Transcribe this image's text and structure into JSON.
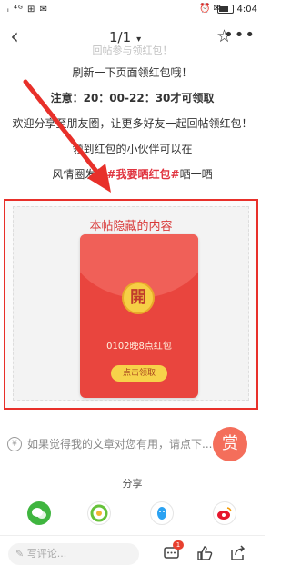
{
  "status_bar": {
    "left": "ᵢ ⁴ᴳ ⊞ ✉",
    "time": "4:04",
    "icons": "⏰ ✉"
  },
  "nav": {
    "back": "‹",
    "page_indicator": "1/1",
    "chevron": "▾",
    "favorite": "☆",
    "more": "•••"
  },
  "article": {
    "faded_line": "回帖参与领红包！",
    "refresh_line": "刷新一下页面领红包哦！",
    "note_label": "注意：",
    "note_time": "20：00-22：30才可领取",
    "invite_line": "欢迎分享至朋友圈，让更多好友一起回帖领红包！",
    "received_line": "领到红包的小伙伴可以在",
    "moment_prefix": "风情圈发帖",
    "moment_tag": "#我要晒红包#",
    "moment_suffix": "晒一晒"
  },
  "hidden_content": {
    "title": "本帖隐藏的内容",
    "open_symbol": "開",
    "packet_title": "0102晚8点红包",
    "claim_label": "点击领取"
  },
  "reward": {
    "yen": "¥",
    "prompt": "如果觉得我的文章对您有用，请点下...",
    "button": "赏"
  },
  "share": {
    "label": "分享",
    "icons": [
      "wechat-icon",
      "moments-icon",
      "qq-icon",
      "weibo-icon"
    ]
  },
  "bottom": {
    "comment_placeholder": "写评论...",
    "comment_count": "1"
  },
  "colors": {
    "annotation_red": "#e8302a",
    "packet_red": "#e9453e",
    "gold": "#f6cf45",
    "reward_orange": "#f46e5b",
    "tag_red": "#e0323e"
  }
}
